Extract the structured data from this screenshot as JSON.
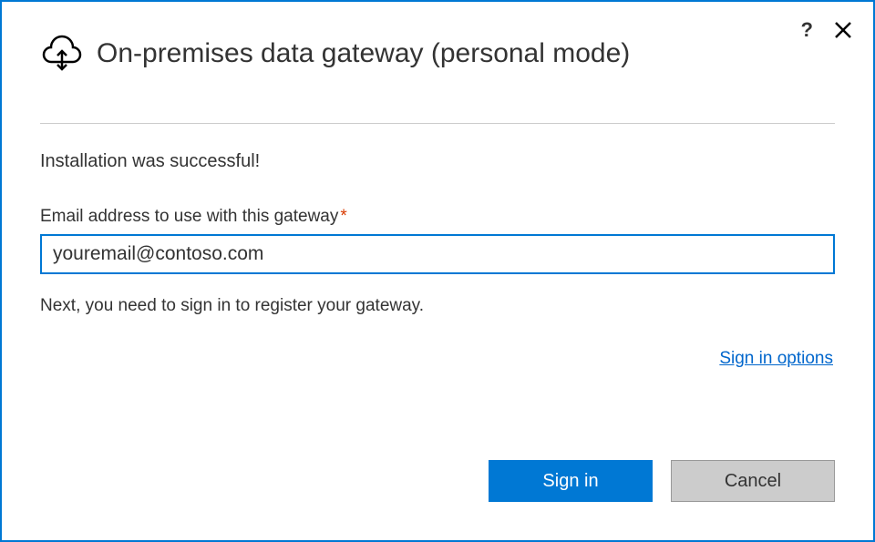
{
  "header": {
    "title": "On-premises data gateway (personal mode)"
  },
  "controls": {
    "help": "?",
    "close": "✕"
  },
  "content": {
    "success_message": "Installation was successful!",
    "email_label": "Email address to use with this gateway",
    "required_mark": "*",
    "email_value": "youremail@contoso.com",
    "instruction": "Next, you need to sign in to register your gateway.",
    "signin_options_label": "Sign in options"
  },
  "footer": {
    "signin_label": "Sign in",
    "cancel_label": "Cancel"
  }
}
